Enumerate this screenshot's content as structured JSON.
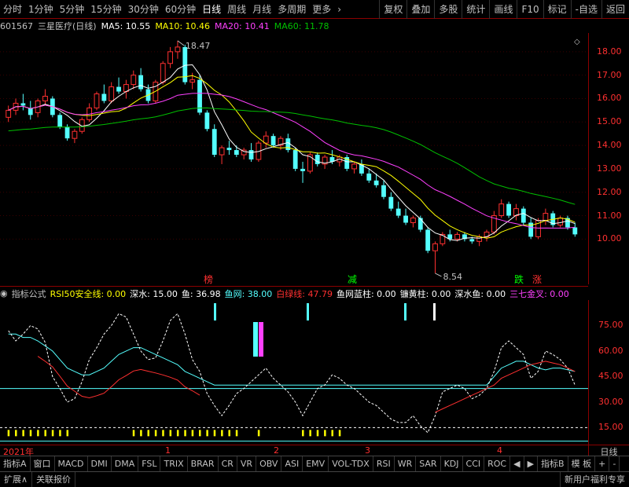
{
  "toolbar": {
    "periods": [
      "分时",
      "1分钟",
      "5分钟",
      "15分钟",
      "30分钟",
      "60分钟",
      "日线",
      "周线",
      "月线",
      "多周期",
      "更多"
    ],
    "active_period": "日线",
    "actions": [
      "复权",
      "叠加",
      "多股",
      "统计",
      "画线",
      "F10",
      "标记",
      "-自选",
      "返回"
    ]
  },
  "stock": {
    "code": "601567",
    "name": "三星医疗(日线)",
    "ma5_label": "MA5: 10.55",
    "ma10_label": "MA10: 10.46",
    "ma20_label": "MA20: 10.41",
    "ma60_label": "MA60: 11.78"
  },
  "colors": {
    "up": "#ff3030",
    "down": "#54ffff",
    "ma5": "#ffffff",
    "ma10": "#ffff00",
    "ma20": "#ff40ff",
    "ma60": "#00c000",
    "axis": "#8b0000"
  },
  "price_axis": [
    "18.00",
    "17.00",
    "16.00",
    "15.00",
    "14.00",
    "13.00",
    "12.00",
    "11.00",
    "10.00"
  ],
  "annotations": {
    "high": "18.47",
    "low": "8.54",
    "signals": [
      {
        "text": "榜",
        "color": "#ff3030"
      },
      {
        "text": "减",
        "color": "#00ff00"
      },
      {
        "text": "跌",
        "color": "#00ff00"
      },
      {
        "text": "涨",
        "color": "#ff3030"
      }
    ]
  },
  "indicator": {
    "name": "指标公式",
    "items": [
      {
        "text": "RSI50安全线: 0.00",
        "color": "#ffff00"
      },
      {
        "text": "深水: 15.00",
        "color": "#ffffff"
      },
      {
        "text": "鱼: 36.98",
        "color": "#ffffff"
      },
      {
        "text": "鱼网: 38.00",
        "color": "#54ffff"
      },
      {
        "text": "白绿线: 47.79",
        "color": "#ff3030"
      },
      {
        "text": "鱼网蓝柱: 0.00",
        "color": "#ffffff"
      },
      {
        "text": "镰黄柱: 0.00",
        "color": "#ffffff"
      },
      {
        "text": "深水鱼: 0.00",
        "color": "#ffffff"
      },
      {
        "text": "三七金叉: 0.00",
        "color": "#ff40ff"
      }
    ],
    "axis": [
      "75.00",
      "60.00",
      "45.00",
      "30.00",
      "15.00"
    ]
  },
  "time_axis": [
    "2021年",
    "1",
    "2",
    "3",
    "4"
  ],
  "period_label": "日线",
  "indicator_tabs": [
    "指标A",
    "窗口",
    "MACD",
    "DMI",
    "DMA",
    "FSL",
    "TRIX",
    "BRAR",
    "CR",
    "VR",
    "OBV",
    "ASI",
    "EMV",
    "VOL-TDX",
    "RSI",
    "WR",
    "SAR",
    "KDJ",
    "CCI",
    "ROC",
    "◀",
    "▶",
    "指标B",
    "模 板",
    "+",
    "-"
  ],
  "status": {
    "left": [
      "扩展∧",
      "关联报价"
    ],
    "right": "新用户福利专享"
  },
  "chart_data": {
    "type": "candlestick",
    "price_range": [
      8.0,
      18.8
    ],
    "candles": [
      [
        15.2,
        15.7,
        15.0,
        15.5
      ],
      [
        15.5,
        16.0,
        15.3,
        15.8
      ],
      [
        15.8,
        16.2,
        15.5,
        15.7
      ],
      [
        15.6,
        15.9,
        15.1,
        15.3
      ],
      [
        15.4,
        16.0,
        15.2,
        15.9
      ],
      [
        15.9,
        16.4,
        15.7,
        16.1
      ],
      [
        16.0,
        16.1,
        15.2,
        15.3
      ],
      [
        15.3,
        15.4,
        14.7,
        14.8
      ],
      [
        14.8,
        14.9,
        14.2,
        14.3
      ],
      [
        14.3,
        14.7,
        14.1,
        14.6
      ],
      [
        14.6,
        15.2,
        14.5,
        15.1
      ],
      [
        15.1,
        15.8,
        15.0,
        15.6
      ],
      [
        15.6,
        16.3,
        15.5,
        16.2
      ],
      [
        16.2,
        16.6,
        15.8,
        15.9
      ],
      [
        15.9,
        16.7,
        15.8,
        16.5
      ],
      [
        16.5,
        16.9,
        16.2,
        16.3
      ],
      [
        16.3,
        16.8,
        16.0,
        16.6
      ],
      [
        16.6,
        17.2,
        16.4,
        17.0
      ],
      [
        17.0,
        17.3,
        16.3,
        16.4
      ],
      [
        16.4,
        16.6,
        15.8,
        15.9
      ],
      [
        15.9,
        16.8,
        15.8,
        16.7
      ],
      [
        16.7,
        17.6,
        16.6,
        17.5
      ],
      [
        17.5,
        18.2,
        17.3,
        18.0
      ],
      [
        18.0,
        18.47,
        17.7,
        18.2
      ],
      [
        18.2,
        18.3,
        16.6,
        16.7
      ],
      [
        16.7,
        17.1,
        16.4,
        16.8
      ],
      [
        16.8,
        17.0,
        15.3,
        15.4
      ],
      [
        15.4,
        15.5,
        14.6,
        14.7
      ],
      [
        14.7,
        14.9,
        13.5,
        13.6
      ],
      [
        13.6,
        14.0,
        13.2,
        13.9
      ],
      [
        13.9,
        14.2,
        13.6,
        13.8
      ],
      [
        13.8,
        14.0,
        13.5,
        13.6
      ],
      [
        13.6,
        13.9,
        13.4,
        13.8
      ],
      [
        13.8,
        14.1,
        13.3,
        13.4
      ],
      [
        13.4,
        14.2,
        13.3,
        14.1
      ],
      [
        14.1,
        14.6,
        13.9,
        14.4
      ],
      [
        14.4,
        14.5,
        13.9,
        14.0
      ],
      [
        14.0,
        14.4,
        13.8,
        14.3
      ],
      [
        14.3,
        14.5,
        13.7,
        13.8
      ],
      [
        13.8,
        13.9,
        12.9,
        13.0
      ],
      [
        13.0,
        13.3,
        12.4,
        12.9
      ],
      [
        12.9,
        13.7,
        12.8,
        13.6
      ],
      [
        13.6,
        13.7,
        13.1,
        13.2
      ],
      [
        13.2,
        13.6,
        13.0,
        13.5
      ],
      [
        13.5,
        13.8,
        13.2,
        13.3
      ],
      [
        13.3,
        13.6,
        13.1,
        13.5
      ],
      [
        13.5,
        13.6,
        12.9,
        13.0
      ],
      [
        13.0,
        13.3,
        12.8,
        13.2
      ],
      [
        13.2,
        13.4,
        12.7,
        12.8
      ],
      [
        12.8,
        13.0,
        12.4,
        12.5
      ],
      [
        12.5,
        12.8,
        12.2,
        12.3
      ],
      [
        12.3,
        12.5,
        11.7,
        11.8
      ],
      [
        11.8,
        12.0,
        11.2,
        11.3
      ],
      [
        11.3,
        11.6,
        10.9,
        11.0
      ],
      [
        11.0,
        11.3,
        10.6,
        10.7
      ],
      [
        10.7,
        11.0,
        10.5,
        10.9
      ],
      [
        10.9,
        11.0,
        10.3,
        10.4
      ],
      [
        10.4,
        10.5,
        9.4,
        9.5
      ],
      [
        9.5,
        9.9,
        8.54,
        9.8
      ],
      [
        9.8,
        10.3,
        9.7,
        10.2
      ],
      [
        10.2,
        10.4,
        9.9,
        10.0
      ],
      [
        10.0,
        10.3,
        9.9,
        10.2
      ],
      [
        10.2,
        10.3,
        9.9,
        10.0
      ],
      [
        10.0,
        10.1,
        9.8,
        9.9
      ],
      [
        9.9,
        10.2,
        9.7,
        10.1
      ],
      [
        10.1,
        10.4,
        9.9,
        10.3
      ],
      [
        10.3,
        11.2,
        10.2,
        11.0
      ],
      [
        11.0,
        11.7,
        10.9,
        11.5
      ],
      [
        11.5,
        11.6,
        10.9,
        11.0
      ],
      [
        11.0,
        11.5,
        10.8,
        11.3
      ],
      [
        11.3,
        11.4,
        10.6,
        10.7
      ],
      [
        10.7,
        10.9,
        10.0,
        10.1
      ],
      [
        10.1,
        10.9,
        10.0,
        10.8
      ],
      [
        10.8,
        11.3,
        10.6,
        11.1
      ],
      [
        11.1,
        11.2,
        10.5,
        10.6
      ],
      [
        10.6,
        11.0,
        10.5,
        10.9
      ],
      [
        10.9,
        11.0,
        10.4,
        10.5
      ],
      [
        10.5,
        10.7,
        10.1,
        10.2
      ]
    ],
    "ma60_visible": true,
    "rsi_white_dashed": [
      72,
      66,
      70,
      75,
      73,
      65,
      45,
      38,
      30,
      32,
      42,
      55,
      62,
      70,
      75,
      82,
      80,
      70,
      60,
      55,
      56,
      66,
      78,
      82,
      70,
      55,
      48,
      35,
      28,
      22,
      28,
      35,
      38,
      42,
      46,
      50,
      44,
      40,
      36,
      30,
      22,
      30,
      38,
      40,
      46,
      44,
      40,
      38,
      34,
      30,
      28,
      24,
      20,
      18,
      18,
      22,
      16,
      12,
      22,
      36,
      38,
      40,
      38,
      32,
      34,
      38,
      48,
      62,
      66,
      62,
      58,
      44,
      48,
      60,
      58,
      55,
      50,
      40
    ],
    "rsi_cyan": [
      70,
      70,
      68,
      68,
      66,
      63,
      60,
      55,
      50,
      48,
      46,
      46,
      48,
      50,
      54,
      58,
      60,
      62,
      62,
      60,
      58,
      56,
      54,
      52,
      48,
      46,
      44,
      42,
      40,
      40,
      40,
      40,
      40,
      40,
      40,
      40,
      40,
      40,
      40,
      40,
      40,
      40,
      40,
      40,
      40,
      40,
      40,
      40,
      40,
      40,
      40,
      40,
      40,
      40,
      40,
      40,
      40,
      40,
      40,
      40,
      40,
      40,
      40,
      40,
      40,
      40,
      45,
      50,
      52,
      54,
      54,
      52,
      50,
      49,
      50,
      50,
      49,
      48
    ],
    "rsi_red": [
      null,
      null,
      null,
      null,
      null,
      null,
      null,
      null,
      null,
      null,
      null,
      null,
      null,
      null,
      null,
      null,
      null,
      null,
      null,
      null,
      null,
      null,
      null,
      null,
      null,
      null,
      null,
      null,
      null,
      null,
      null,
      null,
      null,
      null,
      null,
      null,
      null,
      null,
      null,
      null,
      null,
      null,
      null,
      null,
      null,
      null,
      null,
      null,
      null,
      null,
      null,
      null,
      null,
      null,
      null,
      null,
      null,
      null,
      24,
      26,
      28,
      30,
      32,
      34,
      36,
      38,
      40,
      44,
      46,
      48,
      50,
      52,
      53,
      54,
      53,
      52,
      50,
      48
    ]
  }
}
